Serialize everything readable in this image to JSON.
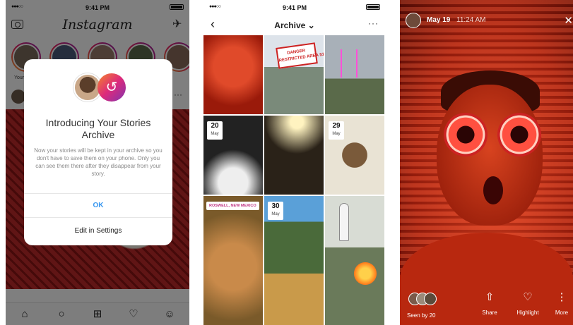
{
  "status_bar": {
    "time": "9:41 PM",
    "signal": "●●●○○"
  },
  "phone1": {
    "app_title": "Instagram",
    "stories": [
      {
        "label": "Your"
      }
    ],
    "post_more": "···",
    "modal": {
      "title": "Introducing Your Stories Archive",
      "body": "Now your stories will be kept in your archive so you don't have to save them on your phone. Only you can see them there after they disappear from your story.",
      "ok_label": "OK",
      "settings_label": "Edit in Settings"
    }
  },
  "phone2": {
    "title": "Archive",
    "title_chevron": "⌄",
    "more": "···",
    "cells": [
      {
        "date_day": "",
        "date_month": "",
        "location": ""
      },
      {
        "date_day": "",
        "date_month": "",
        "location": ""
      },
      {
        "date_day": "",
        "date_month": "",
        "location": ""
      },
      {
        "date_day": "20",
        "date_month": "May",
        "location": ""
      },
      {
        "date_day": "",
        "date_month": "",
        "location": ""
      },
      {
        "date_day": "29",
        "date_month": "May",
        "location": ""
      },
      {
        "date_day": "",
        "date_month": "",
        "location": "ROSWELL, NEW MEXICO"
      },
      {
        "date_day": "30",
        "date_month": "May",
        "location": ""
      },
      {
        "date_day": "",
        "date_month": "",
        "location": ""
      }
    ],
    "sign_text": "DANGER\nRESTRICTED AREA 51"
  },
  "phone3": {
    "date": "May 19",
    "time": "11:24 AM",
    "close": "✕",
    "seen_label": "Seen by 20",
    "actions": [
      {
        "label": "Share",
        "icon": "share-icon"
      },
      {
        "label": "Highlight",
        "icon": "highlight-icon"
      },
      {
        "label": "More",
        "icon": "more-icon"
      }
    ]
  },
  "colors": {
    "accent_blue": "#3897f0",
    "story_gradient": "#dd2a7b",
    "story_bg": "#c2321a"
  }
}
